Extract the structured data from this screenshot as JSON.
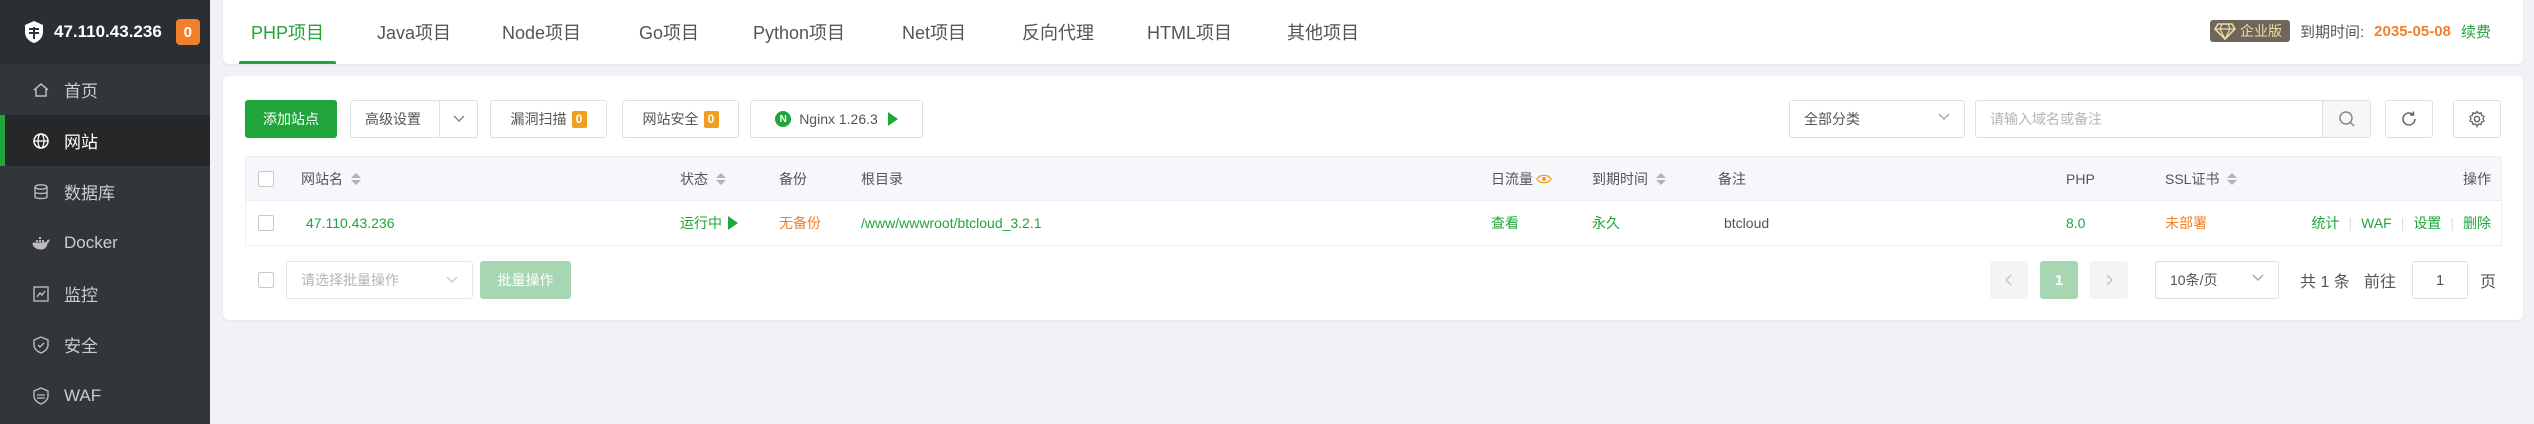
{
  "server": {
    "ip": "47.110.43.236",
    "notice_count": "0"
  },
  "sidebar": {
    "items": [
      {
        "label": "首页",
        "icon": "home-icon"
      },
      {
        "label": "网站",
        "icon": "globe-icon",
        "active": true
      },
      {
        "label": "数据库",
        "icon": "database-icon"
      },
      {
        "label": "Docker",
        "icon": "docker-icon"
      },
      {
        "label": "监控",
        "icon": "monitor-icon"
      },
      {
        "label": "安全",
        "icon": "shield-icon"
      },
      {
        "label": "WAF",
        "icon": "waf-shield-icon"
      }
    ]
  },
  "tabs": [
    "PHP项目",
    "Java项目",
    "Node项目",
    "Go项目",
    "Python项目",
    "Net项目",
    "反向代理",
    "HTML项目",
    "其他项目"
  ],
  "active_tab": "PHP项目",
  "enterprise": {
    "badge": "企业版",
    "expire_label": "到期时间:",
    "expire_date": "2035-05-08",
    "renew": "续费"
  },
  "toolbar": {
    "add_site": "添加站点",
    "advanced": "高级设置",
    "vuln_scan": "漏洞扫描",
    "vuln_count": "0",
    "site_security": "网站安全",
    "security_count": "0",
    "nginx": "Nginx 1.26.3",
    "category": "全部分类",
    "search_placeholder": "请输入域名或备注"
  },
  "table": {
    "headers": {
      "name": "网站名",
      "status": "状态",
      "backup": "备份",
      "root": "根目录",
      "traffic": "日流量",
      "expire": "到期时间",
      "remark": "备注",
      "php": "PHP",
      "ssl": "SSL证书",
      "ops": "操作"
    },
    "rows": [
      {
        "name": "47.110.43.236",
        "status": "运行中",
        "backup": "无备份",
        "root": "/www/wwwroot/btcloud_3.2.1",
        "traffic": "查看",
        "expire": "永久",
        "remark": "btcloud",
        "php": "8.0",
        "ssl": "未部署",
        "ops": [
          "统计",
          "WAF",
          "设置",
          "删除"
        ]
      }
    ]
  },
  "footer": {
    "batch_placeholder": "请选择批量操作",
    "batch_button": "批量操作",
    "current_page": "1",
    "per_page": "10条/页",
    "total": "共 1 条",
    "goto_label": "前往",
    "goto_value": "1",
    "page_unit": "页"
  },
  "colors": {
    "accent": "#20a53a",
    "warning": "#f0802c",
    "sidebar": "#32363a"
  }
}
